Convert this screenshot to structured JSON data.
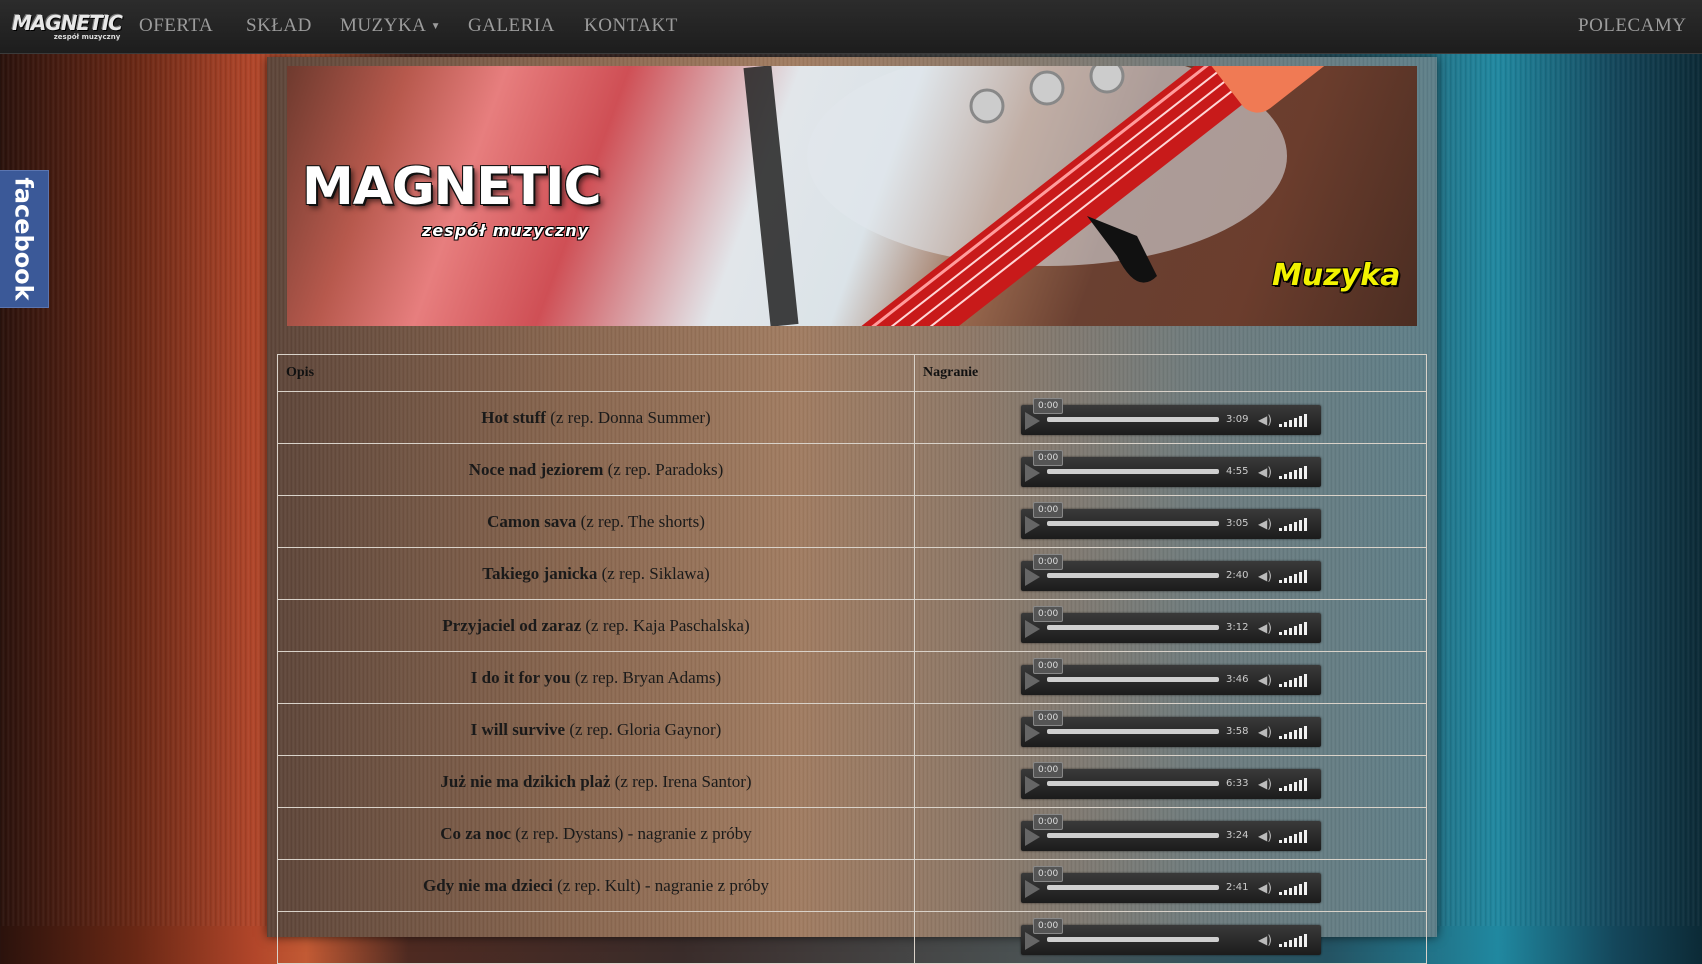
{
  "nav": {
    "brand": {
      "main": "MAGNETIC",
      "sub": "zespół muzyczny"
    },
    "items": [
      {
        "label": "OFERTA"
      },
      {
        "label": "SKŁAD"
      },
      {
        "label": "MUZYKA",
        "has_dropdown": true
      },
      {
        "label": "GALERIA"
      },
      {
        "label": "KONTAKT"
      }
    ],
    "right_label": "POLECAMY"
  },
  "facebook_tab": {
    "label": "facebook"
  },
  "banner": {
    "logo": "MAGNETIC",
    "logo_sub": "zespół muzyczny",
    "caption": "Muzyka"
  },
  "table": {
    "headers": {
      "desc": "Opis",
      "rec": "Nagranie"
    },
    "rows": [
      {
        "title": "Hot stuff",
        "rep": "(z rep. Donna Summer)",
        "note": "",
        "current": "0:00",
        "duration": "3:09"
      },
      {
        "title": "Noce nad jeziorem",
        "rep": "(z rep. Paradoks)",
        "note": "",
        "current": "0:00",
        "duration": "4:55"
      },
      {
        "title": "Camon sava",
        "rep": "(z rep. The shorts)",
        "note": "",
        "current": "0:00",
        "duration": "3:05"
      },
      {
        "title": "Takiego janicka",
        "rep": "(z rep. Siklawa)",
        "note": "",
        "current": "0:00",
        "duration": "2:40"
      },
      {
        "title": "Przyjaciel od zaraz",
        "rep": "(z rep. Kaja Paschalska)",
        "note": "",
        "current": "0:00",
        "duration": "3:12"
      },
      {
        "title": "I do it for you",
        "rep": "(z rep. Bryan Adams)",
        "note": "",
        "current": "0:00",
        "duration": "3:46"
      },
      {
        "title": "I will survive",
        "rep": "(z rep. Gloria Gaynor)",
        "note": "",
        "current": "0:00",
        "duration": "3:58"
      },
      {
        "title": "Już nie ma dzikich plaż",
        "rep": "(z rep. Irena Santor)",
        "note": "",
        "current": "0:00",
        "duration": "6:33"
      },
      {
        "title": "Co za noc",
        "rep": "(z rep. Dystans)",
        "note": " - nagranie z próby",
        "current": "0:00",
        "duration": "3:24"
      },
      {
        "title": "Gdy nie ma dzieci",
        "rep": "(z rep. Kult)",
        "note": " - nagranie z próby",
        "current": "0:00",
        "duration": "2:41"
      },
      {
        "title": "",
        "rep": "",
        "note": "",
        "current": "0:00",
        "duration": ""
      }
    ]
  },
  "icons": {
    "play": "play-icon",
    "mute": "speaker-icon",
    "volume": "volume-bars-icon",
    "dropdown": "caret-down-icon"
  }
}
